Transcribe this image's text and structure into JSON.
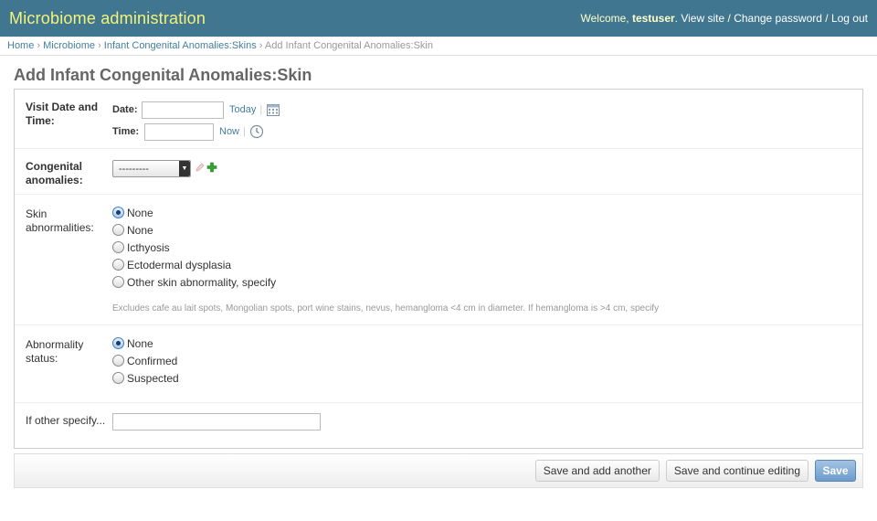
{
  "header": {
    "title": "Microbiome administration",
    "welcome": "Welcome,",
    "username": "testuser",
    "view_site": "View site",
    "change_password": "Change password",
    "log_out": "Log out"
  },
  "breadcrumbs": [
    "Home",
    "Microbiome",
    "Infant Congenital Anomalies:Skins",
    "Add Infant Congenital Anomalies:Skin"
  ],
  "page_title": "Add Infant Congenital Anomalies:Skin",
  "form": {
    "visit": {
      "label": "Visit Date and Time:",
      "date_label": "Date:",
      "date_value": "",
      "today_link": "Today",
      "time_label": "Time:",
      "time_value": "",
      "now_link": "Now",
      "pipe": "|"
    },
    "congenital": {
      "label": "Congenital anomalies:",
      "selected": "---------"
    },
    "skin": {
      "label": "Skin abnormalities:",
      "options": [
        "None",
        "None",
        "Icthyosis",
        "Ectodermal dysplasia",
        "Other skin abnormality, specify"
      ],
      "selected_index": 0,
      "help": "Excludes cafe au lait spots, Mongolian spots, port wine stains, nevus, hemangloma <4 cm in diameter. If hemangloma is >4 cm, specify"
    },
    "abnormality_status": {
      "label": "Abnormality status:",
      "options": [
        "None",
        "Confirmed",
        "Suspected"
      ],
      "selected_index": 0
    },
    "other_specify": {
      "label": "If other specify...",
      "value": ""
    }
  },
  "buttons": {
    "save_add_another": "Save and add another",
    "save_continue": "Save and continue editing",
    "save": "Save"
  },
  "icons": {
    "calendar": "calendar-icon",
    "clock": "clock-icon",
    "edit": "pencil-icon",
    "add": "plus-icon"
  },
  "colors": {
    "header_bg": "#417690",
    "branding": "#f4f379",
    "link": "#447e9b"
  }
}
